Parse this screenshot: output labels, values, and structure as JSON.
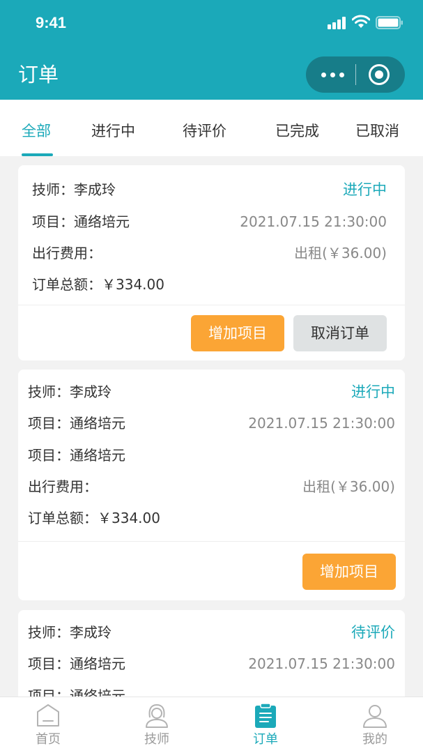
{
  "status_bar": {
    "time": "9:41"
  },
  "nav": {
    "title": "订单"
  },
  "tabs": [
    {
      "label": "全部",
      "active": true
    },
    {
      "label": "进行中"
    },
    {
      "label": "待评价"
    },
    {
      "label": "已完成"
    },
    {
      "label": "已取消"
    }
  ],
  "orders": [
    {
      "tech_label": "技师：",
      "tech": "李成玲",
      "status": "进行中",
      "project_label": "项目：",
      "project": "通络培元",
      "datetime": "2021.07.15 21:30:00",
      "travel_label": "出行费用：",
      "travel_fee": "出租(￥36.00)",
      "total_label": "订单总额：",
      "total": "￥334.00",
      "btn_add": "增加项目",
      "btn_cancel": "取消订单"
    },
    {
      "tech_label": "技师：",
      "tech": "李成玲",
      "status": "进行中",
      "project_label": "项目：",
      "project": "通络培元",
      "datetime": "2021.07.15 21:30:00",
      "project2_label": "项目：",
      "project2": "通络培元",
      "travel_label": "出行费用：",
      "travel_fee": "出租(￥36.00)",
      "total_label": "订单总额：",
      "total": "￥334.00",
      "btn_add": "增加项目"
    },
    {
      "tech_label": "技师：",
      "tech": "李成玲",
      "status": "待评价",
      "project_label": "项目：",
      "project": "通络培元",
      "datetime": "2021.07.15 21:30:00",
      "project2_label": "项目：",
      "project2": "通络培元"
    }
  ],
  "tabbar": [
    {
      "label": "首页",
      "icon": "home-icon"
    },
    {
      "label": "技师",
      "icon": "technician-icon"
    },
    {
      "label": "订单",
      "icon": "order-icon",
      "active": true
    },
    {
      "label": "我的",
      "icon": "profile-icon"
    }
  ],
  "colors": {
    "brand": "#1ba9b9",
    "accent_orange": "#fba535",
    "muted_button": "#dfe2e3"
  }
}
